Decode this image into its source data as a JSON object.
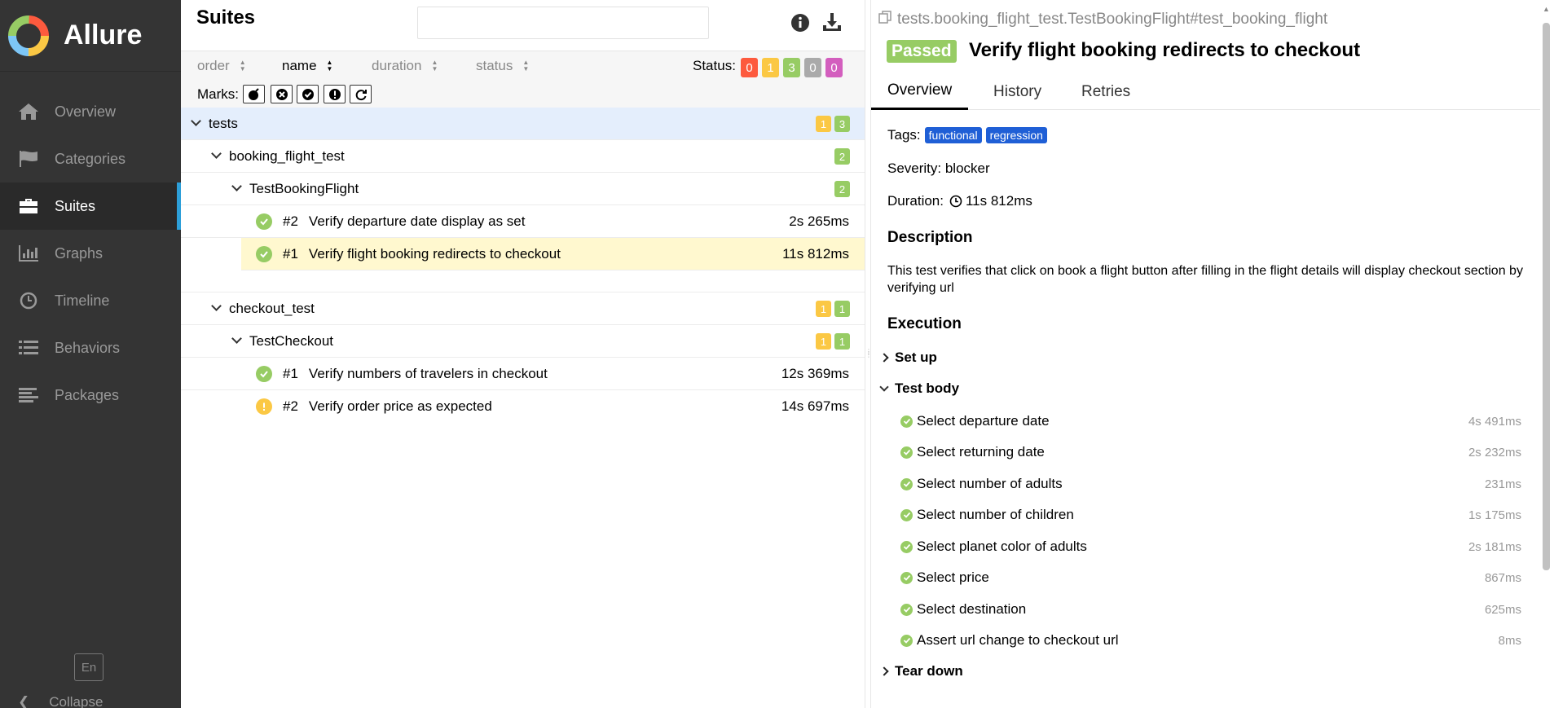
{
  "colors": {
    "sidebar": "#343434",
    "accent": "#2d9fd9",
    "passed": "#97cc64",
    "broken": "#fbc844",
    "failed": "#fd5a3e",
    "skipped": "#aaaaaa",
    "unknown": "#d35ebe",
    "tag": "#1f5fd6"
  },
  "sidebar": {
    "brand": "Allure",
    "items": [
      {
        "label": "Overview",
        "icon": "home-icon"
      },
      {
        "label": "Categories",
        "icon": "flag-icon"
      },
      {
        "label": "Suites",
        "icon": "briefcase-icon",
        "active": true
      },
      {
        "label": "Graphs",
        "icon": "bar-chart-icon"
      },
      {
        "label": "Timeline",
        "icon": "clock-icon"
      },
      {
        "label": "Behaviors",
        "icon": "list-icon"
      },
      {
        "label": "Packages",
        "icon": "align-left-icon"
      }
    ],
    "lang": "En",
    "collapse": "Collapse"
  },
  "suites": {
    "title": "Suites",
    "search_value": "",
    "sort": {
      "order": "order",
      "name": "name",
      "duration": "duration",
      "status": "status"
    },
    "status_label": "Status:",
    "status_counts": {
      "failed": "0",
      "broken": "1",
      "passed": "3",
      "skipped": "0",
      "unknown": "0"
    },
    "marks_label": "Marks:",
    "tree": {
      "root": {
        "label": "tests",
        "broken": "1",
        "passed": "3"
      },
      "g1": {
        "label": "booking_flight_test",
        "passed": "2"
      },
      "g1c": {
        "label": "TestBookingFlight",
        "passed": "2"
      },
      "t1": {
        "num": "#2",
        "label": "Verify departure date display as set",
        "time": "2s 265ms"
      },
      "t2": {
        "num": "#1",
        "label": "Verify flight booking redirects to checkout",
        "time": "11s 812ms"
      },
      "g2": {
        "label": "checkout_test",
        "broken": "1",
        "passed": "1"
      },
      "g2c": {
        "label": "TestCheckout",
        "broken": "1",
        "passed": "1"
      },
      "t3": {
        "num": "#1",
        "label": "Verify numbers of travelers in checkout",
        "time": "12s 369ms"
      },
      "t4": {
        "num": "#2",
        "label": "Verify order price as expected",
        "time": "14s 697ms"
      }
    }
  },
  "detail": {
    "fullname": "tests.booking_flight_test.TestBookingFlight#test_booking_flight",
    "status": "Passed",
    "title": "Verify flight booking redirects to checkout",
    "tabs": [
      "Overview",
      "History",
      "Retries"
    ],
    "tags_label": "Tags:",
    "tags": [
      "functional",
      "regression"
    ],
    "severity": "Severity: blocker",
    "duration_label": "Duration:",
    "duration": "11s 812ms",
    "description_heading": "Description",
    "description": "This test verifies that click on book a flight button after filling in the flight details will display checkout section by verifying url",
    "execution_heading": "Execution",
    "setup": "Set up",
    "body": "Test body",
    "teardown": "Tear down",
    "steps": [
      {
        "label": "Select departure date",
        "time": "4s 491ms"
      },
      {
        "label": "Select returning date",
        "time": "2s 232ms"
      },
      {
        "label": "Select number of adults",
        "time": "231ms"
      },
      {
        "label": "Select number of children",
        "time": "1s 175ms"
      },
      {
        "label": "Select planet color of adults",
        "time": "2s 181ms"
      },
      {
        "label": "Select price",
        "time": "867ms"
      },
      {
        "label": "Select destination",
        "time": "625ms"
      },
      {
        "label": "Assert url change to checkout url",
        "time": "8ms"
      }
    ]
  }
}
